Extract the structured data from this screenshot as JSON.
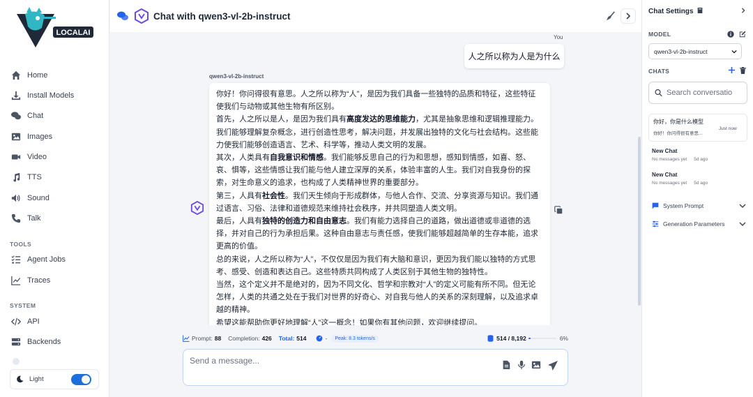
{
  "sidebar": {
    "logo_text": "LOCALAI",
    "nav": [
      {
        "label": "Home",
        "icon": "home-icon"
      },
      {
        "label": "Install Models",
        "icon": "download-icon"
      },
      {
        "label": "Chat",
        "icon": "chat-icon"
      },
      {
        "label": "Images",
        "icon": "image-icon"
      },
      {
        "label": "Video",
        "icon": "video-icon"
      },
      {
        "label": "TTS",
        "icon": "music-icon"
      },
      {
        "label": "Sound",
        "icon": "volume-icon"
      },
      {
        "label": "Talk",
        "icon": "phone-icon"
      }
    ],
    "tools_label": "TOOLS",
    "tools": [
      {
        "label": "Agent Jobs",
        "icon": "tasks-icon"
      },
      {
        "label": "Traces",
        "icon": "line-chart-icon"
      }
    ],
    "system_label": "SYSTEM",
    "system": [
      {
        "label": "API",
        "icon": "code-icon"
      },
      {
        "label": "Backends",
        "icon": "server-icon"
      }
    ],
    "theme_label": "Light",
    "theme_dark": false
  },
  "header": {
    "title": "Chat with qwen3-vl-2b-instruct"
  },
  "conversation": {
    "user_label": "You",
    "user_message": "人之所以称为人是为什么",
    "model_label": "qwen3-vl-2b-instruct",
    "assistant_paragraphs": [
      {
        "pre": "你好！你问得很有意思。人之所以称为“人”，是因为我们具备一些独特的品质和特征，这些特征使我们与动物或其他生物有所区别。",
        "bold": "",
        "post": ""
      },
      {
        "pre": "首先，人之所以是人，是因为我们具有",
        "bold": "高度发达的思维能力",
        "post": "，尤其是抽象思维和逻辑推理能力。我们能够理解复杂概念，进行创造性思考，解决问题，并发展出独特的文化与社会结构。这些能力使我们能够创造语言、艺术、科学等，推动人类文明的发展。"
      },
      {
        "pre": "其次，人类具有",
        "bold": "自我意识和情感",
        "post": "。我们能够反思自己的行为和思想，感知到情感，如喜、怒、哀、惧等，这些情感让我们能与他人建立深厚的关系，体验丰富的人生。我们对自我身份的探索，对生命意义的追求，也构成了人类精神世界的重要部分。"
      },
      {
        "pre": "第三，人具有",
        "bold": "社会性",
        "post": "。我们天生倾向于形成群体，与他人合作、交流、分享资源与知识。我们通过语言、习俗、法律和道德规范来维持社会秩序，并共同塑造人类文明。"
      },
      {
        "pre": "最后，人具有",
        "bold": "独特的创造力和自由意志",
        "post": "。我们有能力选择自己的道路，做出道德或非道德的选择，并对自己的行为承担后果。这种自由意志与责任感，使我们能够超越简单的生存本能，追求更高的价值。"
      },
      {
        "pre": "总的来说，人之所以称为“人”，不仅仅是因为我们有大脑和意识，更因为我们能以独特的方式思考、感受、创造和表达自己。这些特质共同构成了人类区别于其他生物的独特性。",
        "bold": "",
        "post": ""
      },
      {
        "pre": "当然，这个定义并不是绝对的，因为不同文化、哲学和宗教对“人”的定义可能有所不同。但无论怎样，人类的共通之处在于我们对世界的好奇心、对自我与他人的关系的深刻理解，以及追求卓越的精神。",
        "bold": "",
        "post": ""
      },
      {
        "pre": "希望这能帮助你更好地理解“人”这一概念！如果你有其他问题，欢迎继续提问。",
        "bold": "",
        "post": ""
      }
    ]
  },
  "stats": {
    "prompt_label": "Prompt:",
    "prompt_value": "88",
    "completion_label": "Completion:",
    "completion_value": "426",
    "total_label": "Total:",
    "total_value": "514",
    "speed_value": "-",
    "peak_label": "Peak: 8.3 tokens/s",
    "context_value": "514 / 8,192",
    "context_percent_label": "6%",
    "context_fraction": 0.063
  },
  "composer": {
    "placeholder": "Send a message..."
  },
  "right_panel": {
    "title": "Chat Settings",
    "model_label": "MODEL",
    "model_value": "qwen3-vl-2b-instruct",
    "chats_label": "CHATS",
    "search_placeholder": "Search conversatio",
    "chats": [
      {
        "title": "你好，你是什么模型",
        "preview": "你好！你问得很有意思...",
        "time": "Just now"
      },
      {
        "title": "New Chat",
        "preview": "No messages yet",
        "time": "5d ago"
      },
      {
        "title": "New Chat",
        "preview": "No messages yet",
        "time": "5d ago"
      }
    ],
    "system_prompt_label": "System Prompt",
    "gen_params_label": "Generation Parameters"
  },
  "colors": {
    "accent": "#2563eb",
    "brand_teal": "#2fb7c4",
    "brand_purple": "#6d4ae0"
  }
}
